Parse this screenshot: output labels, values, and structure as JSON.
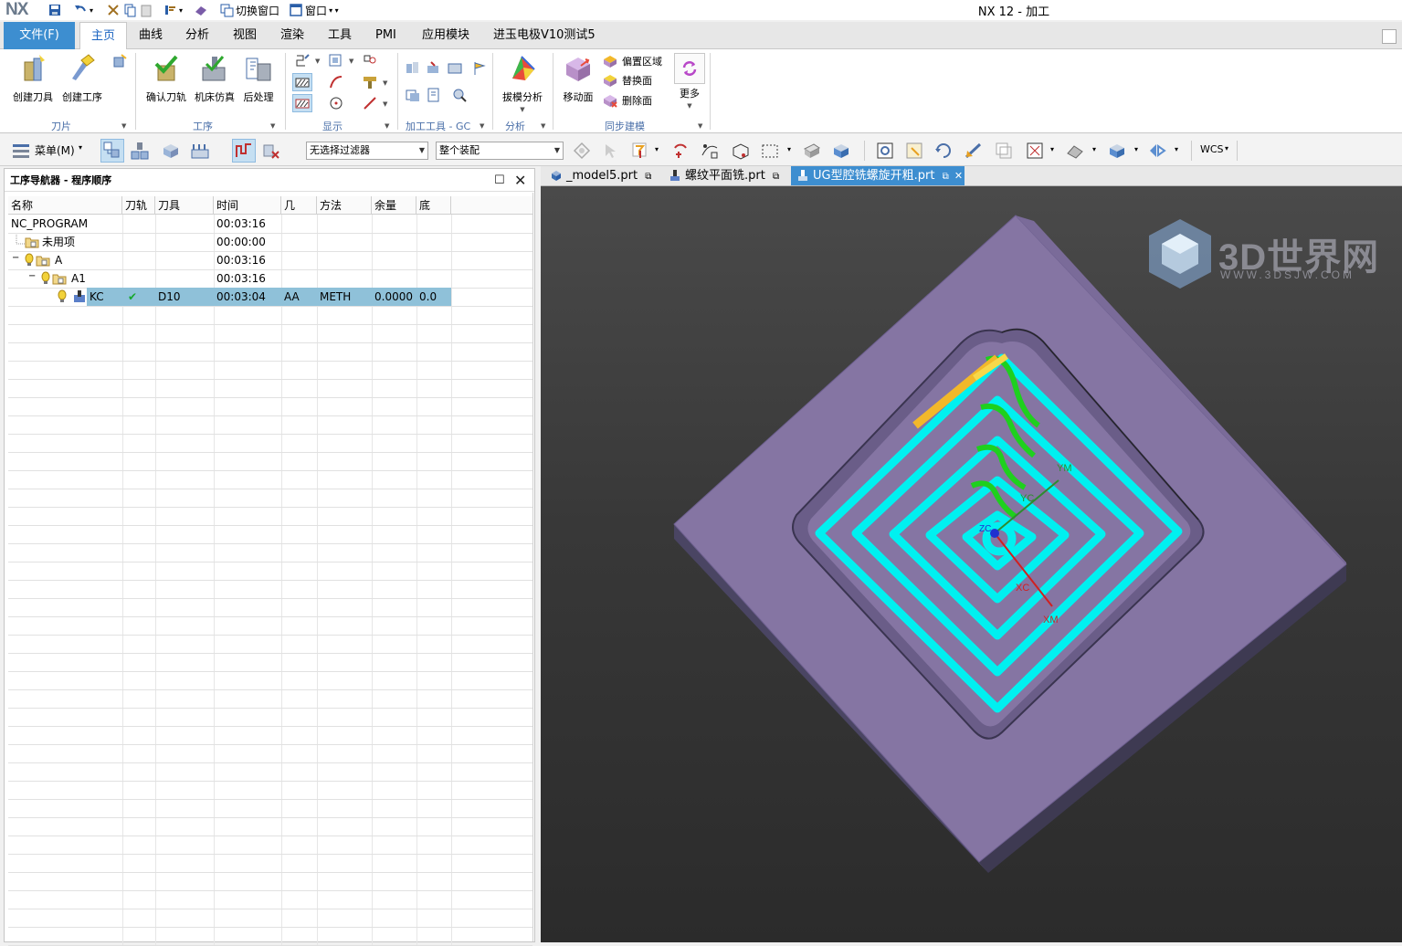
{
  "titlebar": {
    "logo": "NX",
    "switch_window": "切换窗口",
    "window": "窗口",
    "title": "NX 12 - 加工"
  },
  "ribbon_tabs": [
    "文件(F)",
    "主页",
    "曲线",
    "分析",
    "视图",
    "渲染",
    "工具",
    "PMI",
    "应用模块",
    "进玉电极V10测试5"
  ],
  "ribbon": {
    "create_tool": "创建刀具",
    "create_operation": "创建工序",
    "verify_toolpath": "确认刀轨",
    "machine_sim": "机床仿真",
    "postprocess": "后处理",
    "draft_analysis": "拔模分析",
    "move_face": "移动面",
    "offset_region": "偏置区域",
    "replace_face": "替换面",
    "delete_face": "删除面",
    "more": "更多",
    "groups": {
      "tool": "刀片",
      "operation": "工序",
      "display": "显示",
      "machining_tools": "加工工具 - GC",
      "analysis": "分析",
      "sync_modeling": "同步建模"
    }
  },
  "toolbar": {
    "menu": "菜单(M)",
    "filter": "无选择过滤器",
    "assembly": "整个装配",
    "wcs": "WCS"
  },
  "navigator": {
    "title": "工序导航器 - 程序顺序",
    "columns": [
      "名称",
      "刀轨",
      "刀具",
      "时间",
      "几",
      "方法",
      "余量",
      "底"
    ],
    "rows": [
      {
        "name": "NC_PROGRAM",
        "toolpath": "",
        "tool": "",
        "time": "00:03:16",
        "geom": "",
        "method": "",
        "stock": "",
        "floor": ""
      },
      {
        "name": "未用项",
        "toolpath": "",
        "tool": "",
        "time": "00:00:00",
        "geom": "",
        "method": "",
        "stock": "",
        "floor": ""
      },
      {
        "name": "A",
        "toolpath": "",
        "tool": "",
        "time": "00:03:16",
        "geom": "",
        "method": "",
        "stock": "",
        "floor": ""
      },
      {
        "name": "A1",
        "toolpath": "",
        "tool": "",
        "time": "00:03:16",
        "geom": "",
        "method": "",
        "stock": "",
        "floor": ""
      },
      {
        "name": "KC",
        "toolpath": "✔",
        "tool": "D10",
        "time": "00:03:04",
        "geom": "AA",
        "method": "METH",
        "stock": "0.0000",
        "floor": "0.0"
      }
    ]
  },
  "doc_tabs": [
    "_model5.prt",
    "螺纹平面铣.prt",
    "UG型腔铣螺旋开粗.prt"
  ],
  "viewport": {
    "axis_labels": [
      "YM",
      "YC",
      "XC",
      "XM",
      "ZC"
    ],
    "watermark": "3D世界网",
    "watermark_url": "WWW.3DSJW.COM",
    "colors": {
      "part": "#8575a3",
      "toolpath": "#00ffff",
      "engage": "#22cc22",
      "rapid": "#f2b82a",
      "accent": "#3d8ed0"
    }
  }
}
